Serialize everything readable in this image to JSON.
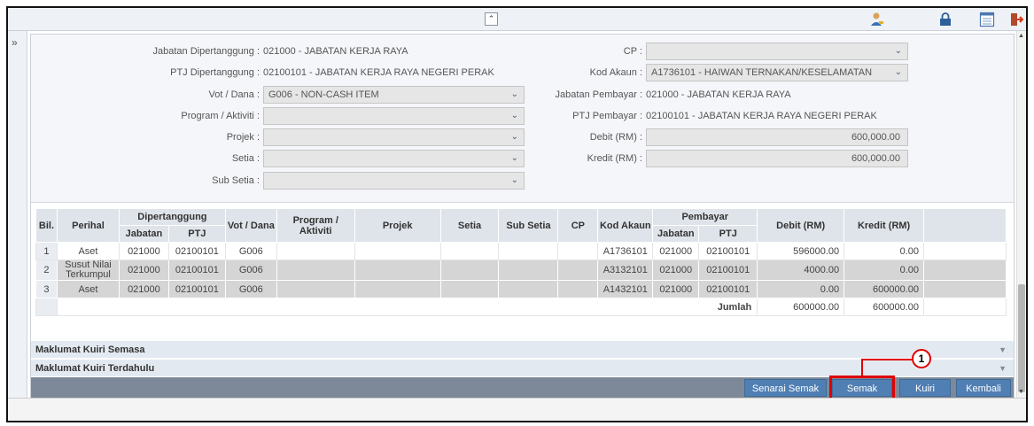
{
  "topbar": {
    "collapse_glyph": "⌃",
    "icons": [
      "user-icon",
      "lock-icon",
      "list-icon",
      "exit-icon"
    ]
  },
  "rail": {
    "toggle_glyph": "»"
  },
  "form": {
    "left": [
      {
        "label": "Jabatan Dipertanggung :",
        "value": "021000 - JABATAN KERJA RAYA"
      },
      {
        "label": "PTJ Dipertanggung :",
        "value": "02100101 - JABATAN KERJA RAYA NEGERI PERAK"
      },
      {
        "label": "Vot / Dana :",
        "value": "G006 - NON-CASH ITEM"
      },
      {
        "label": "Program / Aktiviti :",
        "value": ""
      },
      {
        "label": "Projek :",
        "value": ""
      },
      {
        "label": "Setia :",
        "value": ""
      },
      {
        "label": "Sub Setia :",
        "value": ""
      }
    ],
    "right": [
      {
        "label": "CP :",
        "value": ""
      },
      {
        "label": "Kod Akaun :",
        "value": "A1736101 - HAIWAN TERNAKAN/KESELAMATAN"
      },
      {
        "label": "Jabatan Pembayar :",
        "value": "021000 - JABATAN KERJA RAYA"
      },
      {
        "label": "PTJ Pembayar :",
        "value": "02100101 - JABATAN KERJA RAYA NEGERI PERAK"
      },
      {
        "label": "Debit (RM) :",
        "value": "600,000.00"
      },
      {
        "label": "Kredit (RM) :",
        "value": "600,000.00"
      }
    ]
  },
  "table": {
    "headers": {
      "bil": "Bil.",
      "perihal": "Perihal",
      "dipertanggung": "Dipertanggung",
      "jabatan": "Jabatan",
      "ptj": "PTJ",
      "vot": "Vot / Dana",
      "program": "Program / Aktiviti",
      "projek": "Projek",
      "setia": "Setia",
      "subsetia": "Sub Setia",
      "cp": "CP",
      "kodakaun": "Kod Akaun",
      "pembayar": "Pembayar",
      "p_jabatan": "Jabatan",
      "p_ptj": "PTJ",
      "debit": "Debit (RM)",
      "kredit": "Kredit (RM)"
    },
    "rows": [
      {
        "bil": "1",
        "perihal": "Aset",
        "jabatan": "021000",
        "ptj": "02100101",
        "vot": "G006",
        "program": "",
        "projek": "",
        "setia": "",
        "subsetia": "",
        "cp": "",
        "kodakaun": "A1736101",
        "p_jabatan": "021000",
        "p_ptj": "02100101",
        "debit": "596000.00",
        "kredit": "0.00"
      },
      {
        "bil": "2",
        "perihal": "Susut Nilai Terkumpul",
        "jabatan": "021000",
        "ptj": "02100101",
        "vot": "G006",
        "program": "",
        "projek": "",
        "setia": "",
        "subsetia": "",
        "cp": "",
        "kodakaun": "A3132101",
        "p_jabatan": "021000",
        "p_ptj": "02100101",
        "debit": "4000.00",
        "kredit": "0.00"
      },
      {
        "bil": "3",
        "perihal": "Aset",
        "jabatan": "021000",
        "ptj": "02100101",
        "vot": "G006",
        "program": "",
        "projek": "",
        "setia": "",
        "subsetia": "",
        "cp": "",
        "kodakaun": "A1432101",
        "p_jabatan": "021000",
        "p_ptj": "02100101",
        "debit": "0.00",
        "kredit": "600000.00"
      }
    ],
    "total": {
      "label": "Jumlah",
      "debit": "600000.00",
      "kredit": "600000.00"
    }
  },
  "accordions": [
    {
      "label": "Maklumat Kuiri Semasa"
    },
    {
      "label": "Maklumat Kuiri Terdahulu"
    }
  ],
  "actions": {
    "senarai_semak": "Senarai Semak",
    "semak": "Semak",
    "kuiri": "Kuiri",
    "kembali": "Kembali"
  },
  "callout": {
    "number": "1"
  },
  "colors": {
    "accent": "#4f7fb3",
    "highlight": "#e00000",
    "action_bar": "#7d8998"
  }
}
